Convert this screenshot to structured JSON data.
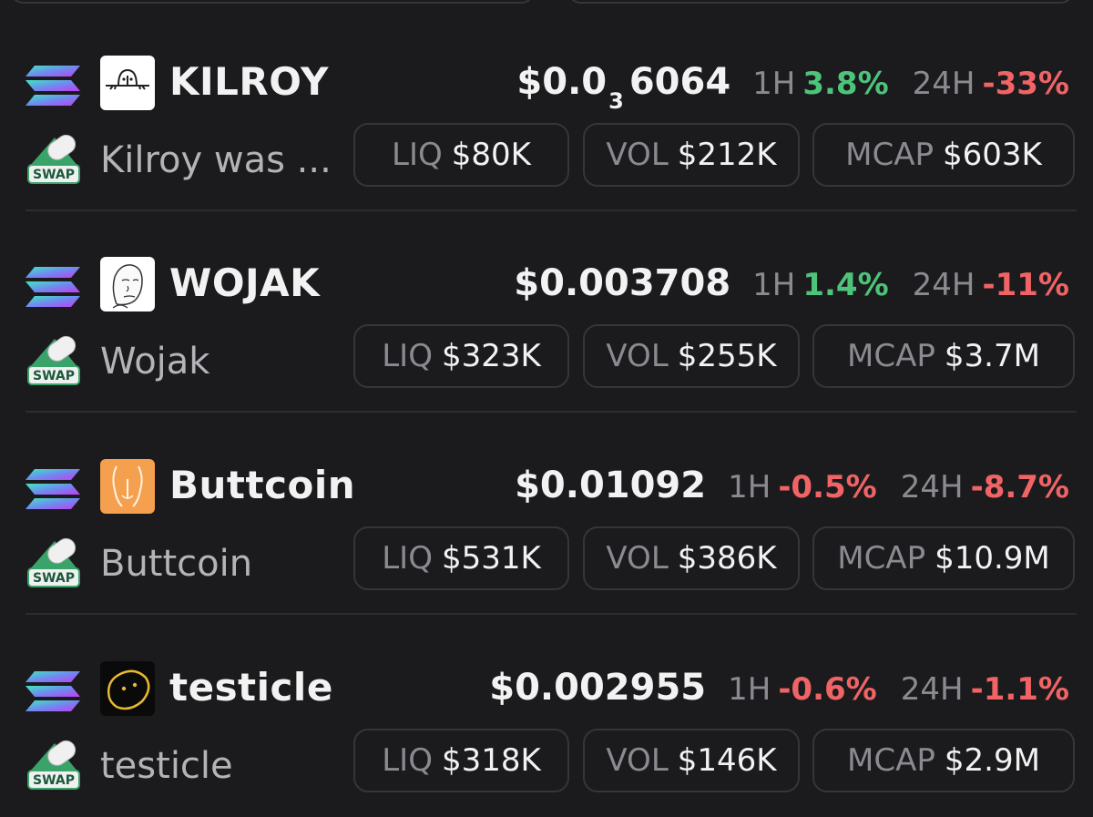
{
  "tokens": [
    {
      "symbol": "KILROY",
      "name": "Kilroy was ...",
      "price_prefix": "$0.0",
      "price_sub": "3",
      "price_rest": "6064",
      "h1_label": "1H",
      "h1": "3.8%",
      "h1_dir": "up",
      "h24_label": "24H",
      "h24": "-33%",
      "h24_dir": "down",
      "liq_label": "LIQ",
      "liq": "$80K",
      "vol_label": "VOL",
      "vol": "$212K",
      "mcap_label": "MCAP",
      "mcap": "$603K",
      "logo": "kilroy-logo"
    },
    {
      "symbol": "WOJAK",
      "name": "Wojak",
      "price": "$0.003708",
      "h1_label": "1H",
      "h1": "1.4%",
      "h1_dir": "up",
      "h24_label": "24H",
      "h24": "-11%",
      "h24_dir": "down",
      "liq_label": "LIQ",
      "liq": "$323K",
      "vol_label": "VOL",
      "vol": "$255K",
      "mcap_label": "MCAP",
      "mcap": "$3.7M",
      "logo": "wojak-logo"
    },
    {
      "symbol": "Buttcoin",
      "name": "Buttcoin",
      "price": "$0.01092",
      "h1_label": "1H",
      "h1": "-0.5%",
      "h1_dir": "down",
      "h24_label": "24H",
      "h24": "-8.7%",
      "h24_dir": "down",
      "liq_label": "LIQ",
      "liq": "$531K",
      "vol_label": "VOL",
      "vol": "$386K",
      "mcap_label": "MCAP",
      "mcap": "$10.9M",
      "logo": "buttcoin-logo"
    },
    {
      "symbol": "testicle",
      "name": "testicle",
      "price": "$0.002955",
      "h1_label": "1H",
      "h1": "-0.6%",
      "h1_dir": "down",
      "h24_label": "24H",
      "h24": "-1.1%",
      "h24_dir": "down",
      "liq_label": "LIQ",
      "liq": "$318K",
      "vol_label": "VOL",
      "vol": "$146K",
      "mcap_label": "MCAP",
      "mcap": "$2.9M",
      "logo": "testicle-logo"
    }
  ],
  "swap_badge": "SWAP",
  "icons": {
    "chain": "solana-icon",
    "swap": "swap-icon"
  },
  "colors": {
    "up": "#4dc47a",
    "down": "#f06466",
    "background": "#1b1b1e"
  }
}
